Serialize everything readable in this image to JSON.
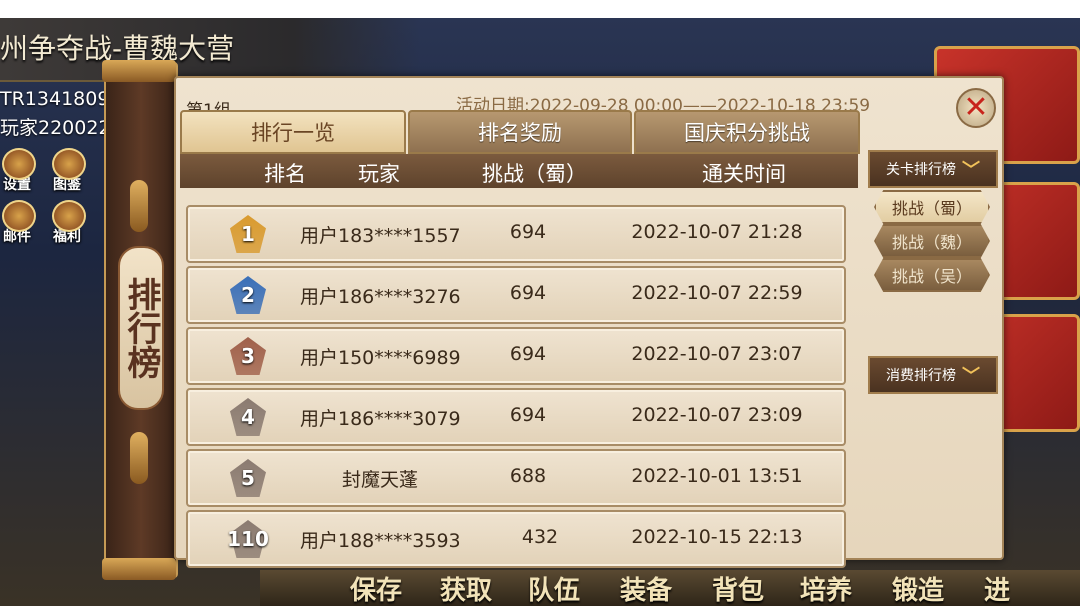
{
  "background": {
    "title": "州争夺战-曹魏大营",
    "player_id": "TR1341809",
    "player_name": "玩家220022",
    "side_icons": [
      "设置",
      "图鉴",
      "邮件",
      "福利"
    ],
    "bottom_menu": [
      "保存",
      "获取",
      "队伍",
      "装备",
      "背包",
      "培养",
      "锻造",
      "进"
    ]
  },
  "leaderboard": {
    "vertical_tab_label": "排行榜",
    "group_label": "第1组",
    "activity_date": "活动日期:2022-09-28 00:00——2022-10-18 23:59",
    "close_icon": "close-x-icon",
    "tabs": [
      {
        "label": "排行一览",
        "active": true
      },
      {
        "label": "排名奖励",
        "active": false
      },
      {
        "label": "国庆积分挑战",
        "active": false
      }
    ],
    "columns": {
      "rank": "排名",
      "player": "玩家",
      "challenge": "挑战（蜀）",
      "clear_time": "通关时间"
    },
    "rows": [
      {
        "rank": "1",
        "player": "用户183****1557",
        "score": "694",
        "time": "2022-10-07 21:28",
        "medal_color": "#d99a2e"
      },
      {
        "rank": "2",
        "player": "用户186****3276",
        "score": "694",
        "time": "2022-10-07 22:59",
        "medal_color": "#3a6fb8"
      },
      {
        "rank": "3",
        "player": "用户150****6989",
        "score": "694",
        "time": "2022-10-07 23:07",
        "medal_color": "#a0604a"
      },
      {
        "rank": "4",
        "player": "用户186****3079",
        "score": "694",
        "time": "2022-10-07 23:09",
        "medal_color": "#8a7a70"
      },
      {
        "rank": "5",
        "player": "封魔天蓬",
        "score": "688",
        "time": "2022-10-01 13:51",
        "medal_color": "#8a7a70"
      },
      {
        "rank": "110",
        "player": "用户188****3593",
        "score": "432",
        "time": "2022-10-15 22:13",
        "medal_color": "#8a7a70"
      }
    ],
    "side": {
      "stage_ranking": "关卡排行榜",
      "sub_items": [
        {
          "label": "挑战（蜀）",
          "active": true
        },
        {
          "label": "挑战（魏）",
          "active": false
        },
        {
          "label": "挑战（吴）",
          "active": false
        }
      ],
      "spend_ranking": "消费排行榜"
    }
  }
}
